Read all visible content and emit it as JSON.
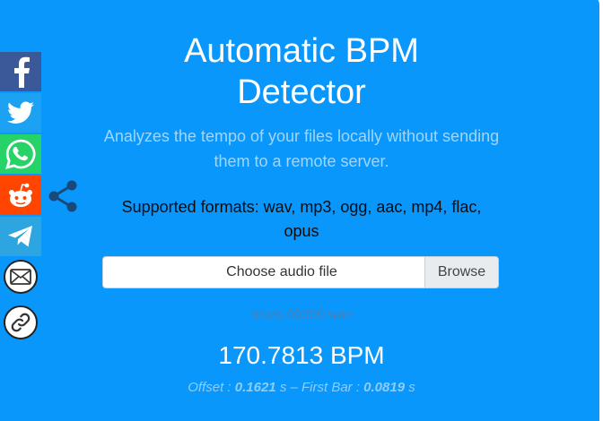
{
  "header": {
    "title_line1": "Automatic BPM",
    "title_line2": "Detector",
    "subtitle": "Analyzes the tempo of your files locally without sending them to a remote server."
  },
  "formats": {
    "text_line1": "Supported formats: wav, mp3, ogg, aac, mp4, flac,",
    "text_line2": "opus"
  },
  "file_input": {
    "placeholder": "Choose audio file",
    "browse_label": "Browse"
  },
  "result": {
    "filename": "blues.00009.wav",
    "bpm": "170.7813 BPM",
    "offset_label": "Offset : ",
    "offset_value": "0.1621",
    "offset_unit": " s – First Bar : ",
    "first_bar_value": "0.0819",
    "first_bar_unit": " s"
  },
  "share": {
    "buttons": [
      {
        "name": "facebook",
        "color": "#3b5998",
        "icon": "facebook-icon"
      },
      {
        "name": "twitter",
        "color": "#1da1f2",
        "icon": "twitter-icon"
      },
      {
        "name": "whatsapp",
        "color": "#25d366",
        "icon": "whatsapp-icon"
      },
      {
        "name": "reddit",
        "color": "#ff4500",
        "icon": "reddit-icon"
      },
      {
        "name": "telegram",
        "color": "#2ca5e0",
        "icon": "telegram-icon"
      },
      {
        "name": "email",
        "icon": "mail-icon"
      },
      {
        "name": "copy-link",
        "icon": "link-icon"
      }
    ],
    "toggle_icon": "share-icon"
  },
  "colors": {
    "background": "#0a97fb",
    "subtitle": "#9ed6ff",
    "filename": "#4e7fb0",
    "offsets": "#8ccdfb"
  }
}
